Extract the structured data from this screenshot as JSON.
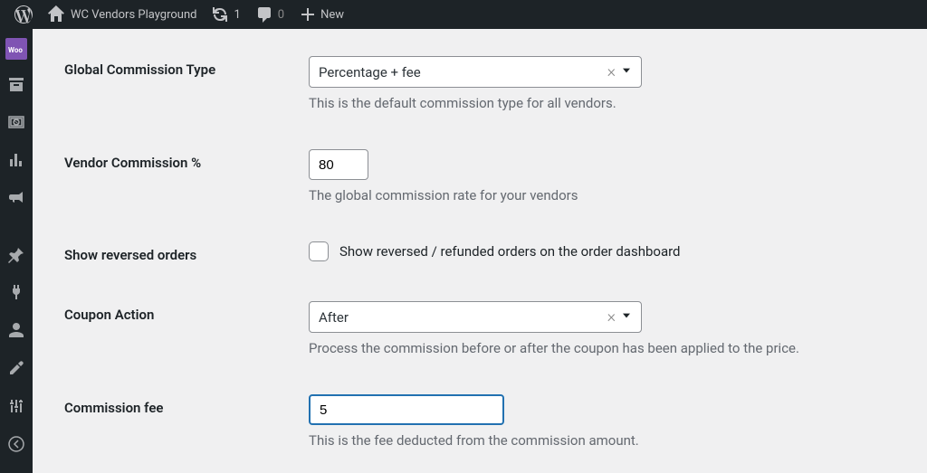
{
  "adminbar": {
    "site_title": "WC Vendors Playground",
    "refresh_count": "1",
    "comments_count": "0",
    "new_label": "New"
  },
  "fields": {
    "commission_type": {
      "label": "Global Commission Type",
      "value": "Percentage + fee",
      "description": "This is the default commission type for all vendors."
    },
    "vendor_commission": {
      "label": "Vendor Commission %",
      "value": "80",
      "description": "The global commission rate for your vendors"
    },
    "show_reversed": {
      "label": "Show reversed orders",
      "checkbox_label": "Show reversed / refunded orders on the order dashboard"
    },
    "coupon_action": {
      "label": "Coupon Action",
      "value": "After",
      "description": "Process the commission before or after the coupon has been applied to the price."
    },
    "commission_fee": {
      "label": "Commission fee",
      "value": "5",
      "description": "This is the fee deducted from the commission amount."
    }
  }
}
